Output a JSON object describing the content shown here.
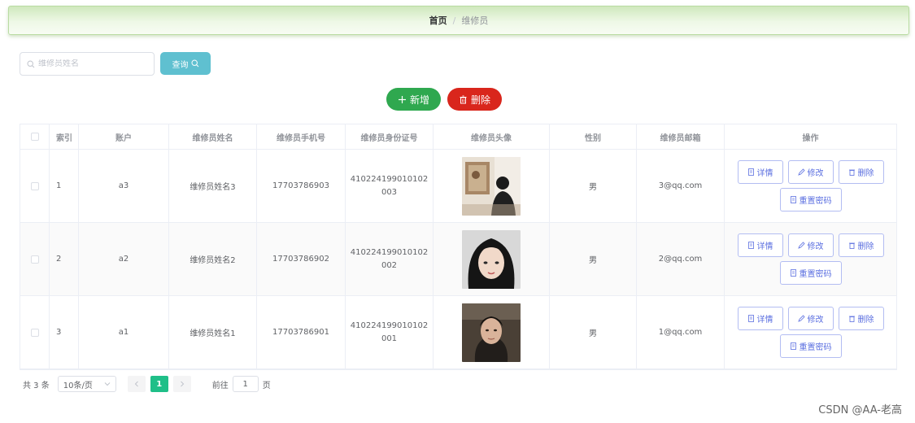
{
  "breadcrumb": {
    "home": "首页",
    "separator": "/",
    "current": "维修员"
  },
  "search": {
    "placeholder": "维修员姓名",
    "value": "",
    "button_label": "查询"
  },
  "actions": {
    "add_label": "新增",
    "delete_label": "删除"
  },
  "table": {
    "columns": [
      "索引",
      "账户",
      "维修员姓名",
      "维修员手机号",
      "维修员身份证号",
      "维修员头像",
      "性别",
      "维修员邮箱",
      "操作"
    ],
    "rows": [
      {
        "index": "1",
        "account": "a3",
        "name": "维修员姓名3",
        "phone": "17703786903",
        "id_number": "410224199010102003",
        "gender": "男",
        "email": "3@qq.com"
      },
      {
        "index": "2",
        "account": "a2",
        "name": "维修员姓名2",
        "phone": "17703786902",
        "id_number": "410224199010102002",
        "gender": "男",
        "email": "2@qq.com"
      },
      {
        "index": "3",
        "account": "a1",
        "name": "维修员姓名1",
        "phone": "17703786901",
        "id_number": "410224199010102001",
        "gender": "男",
        "email": "1@qq.com"
      }
    ],
    "row_actions": {
      "detail": "详情",
      "edit": "修改",
      "delete": "删除",
      "reset_password": "重置密码"
    }
  },
  "pagination": {
    "total": "共 3 条",
    "page_size": "10条/页",
    "current_page": "1",
    "goto_label": "前往",
    "goto_value": "1",
    "page_unit": "页"
  },
  "watermark": "CSDN @AA-老高",
  "colors": {
    "add": "#2fa84f",
    "delete": "#d9261c",
    "query": "#5fc0d0",
    "pager_active": "#1fbf88",
    "op_border": "#b3bdf2"
  }
}
